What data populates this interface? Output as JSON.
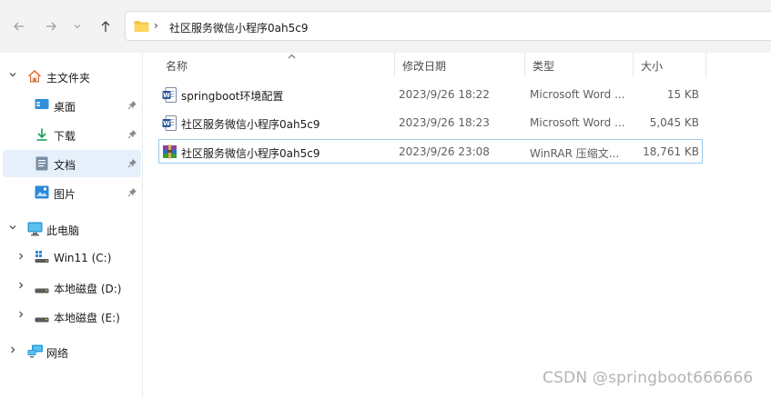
{
  "navigation": {
    "back_icon": "arrow-left-icon",
    "forward_icon": "arrow-right-icon",
    "recent_icon": "chevron-down-icon",
    "up_icon": "arrow-up-icon"
  },
  "address_bar": {
    "separator": "›",
    "path": "社区服务微信小程序0ah5c9"
  },
  "sidebar": {
    "home": "主文件夹",
    "pinned": [
      {
        "label": "桌面",
        "icon": "desktop-icon"
      },
      {
        "label": "下载",
        "icon": "download-icon"
      },
      {
        "label": "文档",
        "icon": "document-icon"
      },
      {
        "label": "图片",
        "icon": "pictures-icon"
      }
    ],
    "this_pc": "此电脑",
    "drives": [
      {
        "label": "Win11 (C:)",
        "icon": "windows-drive-icon"
      },
      {
        "label": "本地磁盘 (D:)",
        "icon": "drive-icon"
      },
      {
        "label": "本地磁盘 (E:)",
        "icon": "drive-icon"
      }
    ],
    "network": "网络",
    "selected_index": 2
  },
  "columns": {
    "name": "名称",
    "date": "修改日期",
    "type": "类型",
    "size": "大小"
  },
  "files": [
    {
      "name": "springboot环境配置",
      "date": "2023/9/26 18:22",
      "type": "Microsoft Word ...",
      "size": "15 KB",
      "icon": "word-document-icon"
    },
    {
      "name": "社区服务微信小程序0ah5c9",
      "date": "2023/9/26 18:23",
      "type": "Microsoft Word ...",
      "size": "5,045 KB",
      "icon": "word-document-icon"
    },
    {
      "name": "社区服务微信小程序0ah5c9",
      "date": "2023/9/26 23:08",
      "type": "WinRAR 压缩文...",
      "size": "18,761 KB",
      "icon": "winrar-archive-icon"
    }
  ],
  "watermark": "CSDN @springboot666666",
  "colors": {
    "toolbar_bg": "#f3f3f3",
    "selection_bg": "#e5f0fb",
    "selection_border": "#99c9ea",
    "folder_yellow": "#f5c24a",
    "word_blue": "#2b579a"
  }
}
